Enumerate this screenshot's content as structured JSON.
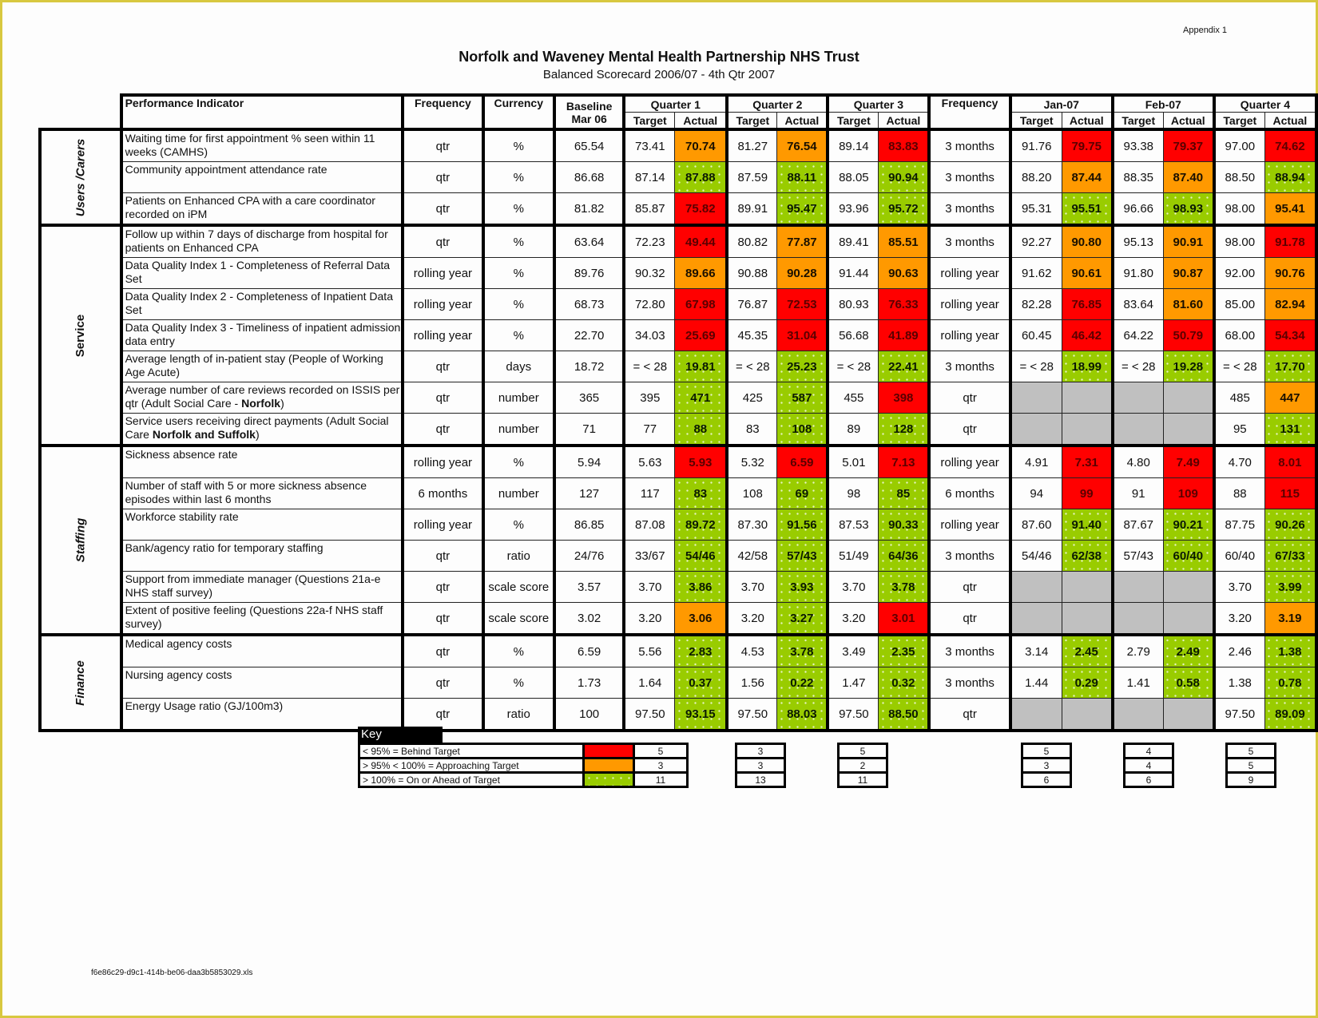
{
  "document": {
    "appendix_label": "Appendix 1",
    "title": "Norfolk and Waveney Mental Health Partnership NHS Trust",
    "subtitle": "Balanced Scorecard 2006/07 - 4th Qtr 2007",
    "filename": "f6e86c29-d9c1-414b-be06-daa3b5853029.xls"
  },
  "colors": {
    "behind_target": "#ff0000",
    "approaching_target": "#ff9900",
    "on_target": "#99cc00",
    "not_applicable": "#c0c0c0",
    "page_border": "#d8c840"
  },
  "headers": {
    "indicator": "Performance Indicator",
    "frequency": "Frequency",
    "currency": "Currency",
    "baseline_line1": "Baseline",
    "baseline_line2": "Mar 06",
    "q1": "Quarter 1",
    "q2": "Quarter 2",
    "q3": "Quarter 3",
    "frequency2": "Frequency",
    "jan": "Jan-07",
    "feb": "Feb-07",
    "q4": "Quarter 4",
    "target": "Target",
    "actual": "Actual"
  },
  "categories": [
    {
      "label": "Users /Carers",
      "rows": 3
    },
    {
      "label": "Service",
      "rows": 7
    },
    {
      "label": "Staffing",
      "rows": 6
    },
    {
      "label": "Finance",
      "rows": 3
    }
  ],
  "rows": [
    {
      "indicator": "Waiting time for first appointment % seen within 11 weeks (CAMHS)",
      "freq": "qtr",
      "currency": "%",
      "baseline": "65.54",
      "q1": {
        "target": "73.41",
        "actual": "70.74",
        "status": "amber"
      },
      "q2": {
        "target": "81.27",
        "actual": "76.54",
        "status": "amber"
      },
      "q3": {
        "target": "89.14",
        "actual": "83.83",
        "status": "red"
      },
      "freq2": "3 months",
      "jan": {
        "target": "91.76",
        "actual": "79.75",
        "status": "red"
      },
      "feb": {
        "target": "93.38",
        "actual": "79.37",
        "status": "red"
      },
      "q4": {
        "target": "97.00",
        "actual": "74.62",
        "status": "red"
      }
    },
    {
      "indicator": "Community appointment attendance rate",
      "freq": "qtr",
      "currency": "%",
      "baseline": "86.68",
      "q1": {
        "target": "87.14",
        "actual": "87.88",
        "status": "green"
      },
      "q2": {
        "target": "87.59",
        "actual": "88.11",
        "status": "green"
      },
      "q3": {
        "target": "88.05",
        "actual": "90.94",
        "status": "green"
      },
      "freq2": "3 months",
      "jan": {
        "target": "88.20",
        "actual": "87.44",
        "status": "amber"
      },
      "feb": {
        "target": "88.35",
        "actual": "87.40",
        "status": "amber"
      },
      "q4": {
        "target": "88.50",
        "actual": "88.94",
        "status": "green"
      }
    },
    {
      "indicator": "Patients on Enhanced CPA with a care coordinator recorded on iPM",
      "freq": "qtr",
      "currency": "%",
      "baseline": "81.82",
      "q1": {
        "target": "85.87",
        "actual": "75.82",
        "status": "red"
      },
      "q2": {
        "target": "89.91",
        "actual": "95.47",
        "status": "green"
      },
      "q3": {
        "target": "93.96",
        "actual": "95.72",
        "status": "green"
      },
      "freq2": "3 months",
      "jan": {
        "target": "95.31",
        "actual": "95.51",
        "status": "green"
      },
      "feb": {
        "target": "96.66",
        "actual": "98.93",
        "status": "green"
      },
      "q4": {
        "target": "98.00",
        "actual": "95.41",
        "status": "amber"
      }
    },
    {
      "indicator": "Follow up within 7 days of discharge from hospital for patients on Enhanced CPA",
      "freq": "qtr",
      "currency": "%",
      "baseline": "63.64",
      "q1": {
        "target": "72.23",
        "actual": "49.44",
        "status": "red"
      },
      "q2": {
        "target": "80.82",
        "actual": "77.87",
        "status": "amber"
      },
      "q3": {
        "target": "89.41",
        "actual": "85.51",
        "status": "amber"
      },
      "freq2": "3 months",
      "jan": {
        "target": "92.27",
        "actual": "90.80",
        "status": "amber"
      },
      "feb": {
        "target": "95.13",
        "actual": "90.91",
        "status": "amber"
      },
      "q4": {
        "target": "98.00",
        "actual": "91.78",
        "status": "red"
      }
    },
    {
      "indicator": "Data Quality Index 1 - Completeness of Referral Data Set",
      "freq": "rolling year",
      "currency": "%",
      "baseline": "89.76",
      "q1": {
        "target": "90.32",
        "actual": "89.66",
        "status": "amber"
      },
      "q2": {
        "target": "90.88",
        "actual": "90.28",
        "status": "amber"
      },
      "q3": {
        "target": "91.44",
        "actual": "90.63",
        "status": "amber"
      },
      "freq2": "rolling year",
      "jan": {
        "target": "91.62",
        "actual": "90.61",
        "status": "amber"
      },
      "feb": {
        "target": "91.80",
        "actual": "90.87",
        "status": "amber"
      },
      "q4": {
        "target": "92.00",
        "actual": "90.76",
        "status": "amber"
      }
    },
    {
      "indicator": "Data Quality Index 2 - Completeness of Inpatient Data Set",
      "freq": "rolling year",
      "currency": "%",
      "baseline": "68.73",
      "q1": {
        "target": "72.80",
        "actual": "67.98",
        "status": "red"
      },
      "q2": {
        "target": "76.87",
        "actual": "72.53",
        "status": "red"
      },
      "q3": {
        "target": "80.93",
        "actual": "76.33",
        "status": "red"
      },
      "freq2": "rolling year",
      "jan": {
        "target": "82.28",
        "actual": "76.85",
        "status": "red"
      },
      "feb": {
        "target": "83.64",
        "actual": "81.60",
        "status": "amber"
      },
      "q4": {
        "target": "85.00",
        "actual": "82.94",
        "status": "amber"
      }
    },
    {
      "indicator": "Data Quality Index 3 - Timeliness of inpatient admission data entry",
      "freq": "rolling year",
      "currency": "%",
      "baseline": "22.70",
      "q1": {
        "target": "34.03",
        "actual": "25.69",
        "status": "red"
      },
      "q2": {
        "target": "45.35",
        "actual": "31.04",
        "status": "red"
      },
      "q3": {
        "target": "56.68",
        "actual": "41.89",
        "status": "red"
      },
      "freq2": "rolling year",
      "jan": {
        "target": "60.45",
        "actual": "46.42",
        "status": "red"
      },
      "feb": {
        "target": "64.22",
        "actual": "50.79",
        "status": "red"
      },
      "q4": {
        "target": "68.00",
        "actual": "54.34",
        "status": "red"
      }
    },
    {
      "indicator": "Average length of in-patient stay (People of Working Age Acute)",
      "freq": "qtr",
      "currency": "days",
      "baseline": "18.72",
      "q1": {
        "target": "= < 28",
        "actual": "19.81",
        "status": "green"
      },
      "q2": {
        "target": "= < 28",
        "actual": "25.23",
        "status": "green"
      },
      "q3": {
        "target": "= < 28",
        "actual": "22.41",
        "status": "green"
      },
      "freq2": "3 months",
      "jan": {
        "target": "= < 28",
        "actual": "18.99",
        "status": "green"
      },
      "feb": {
        "target": "= < 28",
        "actual": "19.28",
        "status": "green"
      },
      "q4": {
        "target": "= < 28",
        "actual": "17.70",
        "status": "green"
      }
    },
    {
      "indicator": "Average number of care reviews recorded on ISSIS per qtr (Adult Social Care - ",
      "indicator_bold": "Norfolk",
      "indicator_tail": ")",
      "freq": "qtr",
      "currency": "number",
      "baseline": "365",
      "q1": {
        "target": "395",
        "actual": "471",
        "status": "green"
      },
      "q2": {
        "target": "425",
        "actual": "587",
        "status": "green"
      },
      "q3": {
        "target": "455",
        "actual": "398",
        "status": "red"
      },
      "freq2": "qtr",
      "jan": {
        "target": "",
        "actual": "",
        "status": "grey"
      },
      "feb": {
        "target": "",
        "actual": "",
        "status": "grey"
      },
      "q4": {
        "target": "485",
        "actual": "447",
        "status": "amber"
      }
    },
    {
      "indicator": "Service users receiving direct payments (Adult Social Care ",
      "indicator_bold": "Norfolk and Suffolk",
      "indicator_tail": ")",
      "freq": "qtr",
      "currency": "number",
      "baseline": "71",
      "q1": {
        "target": "77",
        "actual": "88",
        "status": "green"
      },
      "q2": {
        "target": "83",
        "actual": "108",
        "status": "green"
      },
      "q3": {
        "target": "89",
        "actual": "128",
        "status": "green"
      },
      "freq2": "qtr",
      "jan": {
        "target": "",
        "actual": "",
        "status": "grey"
      },
      "feb": {
        "target": "",
        "actual": "",
        "status": "grey"
      },
      "q4": {
        "target": "95",
        "actual": "131",
        "status": "green"
      }
    },
    {
      "indicator": "Sickness absence rate",
      "freq": "rolling year",
      "currency": "%",
      "baseline": "5.94",
      "q1": {
        "target": "5.63",
        "actual": "5.93",
        "status": "red"
      },
      "q2": {
        "target": "5.32",
        "actual": "6.59",
        "status": "red"
      },
      "q3": {
        "target": "5.01",
        "actual": "7.13",
        "status": "red"
      },
      "freq2": "rolling year",
      "jan": {
        "target": "4.91",
        "actual": "7.31",
        "status": "red"
      },
      "feb": {
        "target": "4.80",
        "actual": "7.49",
        "status": "red"
      },
      "q4": {
        "target": "4.70",
        "actual": "8.01",
        "status": "red"
      }
    },
    {
      "indicator": "Number of staff with 5 or more sickness absence episodes within last 6 months",
      "freq": "6 months",
      "currency": "number",
      "baseline": "127",
      "q1": {
        "target": "117",
        "actual": "83",
        "status": "green"
      },
      "q2": {
        "target": "108",
        "actual": "69",
        "status": "green"
      },
      "q3": {
        "target": "98",
        "actual": "85",
        "status": "green"
      },
      "freq2": "6 months",
      "jan": {
        "target": "94",
        "actual": "99",
        "status": "red"
      },
      "feb": {
        "target": "91",
        "actual": "109",
        "status": "red"
      },
      "q4": {
        "target": "88",
        "actual": "115",
        "status": "red"
      }
    },
    {
      "indicator": "Workforce stability rate",
      "freq": "rolling year",
      "currency": "%",
      "baseline": "86.85",
      "q1": {
        "target": "87.08",
        "actual": "89.72",
        "status": "green"
      },
      "q2": {
        "target": "87.30",
        "actual": "91.56",
        "status": "green"
      },
      "q3": {
        "target": "87.53",
        "actual": "90.33",
        "status": "green"
      },
      "freq2": "rolling year",
      "jan": {
        "target": "87.60",
        "actual": "91.40",
        "status": "green"
      },
      "feb": {
        "target": "87.67",
        "actual": "90.21",
        "status": "green"
      },
      "q4": {
        "target": "87.75",
        "actual": "90.26",
        "status": "green"
      }
    },
    {
      "indicator": "Bank/agency ratio for temporary staffing",
      "freq": "qtr",
      "currency": "ratio",
      "baseline": "24/76",
      "q1": {
        "target": "33/67",
        "actual": "54/46",
        "status": "green"
      },
      "q2": {
        "target": "42/58",
        "actual": "57/43",
        "status": "green"
      },
      "q3": {
        "target": "51/49",
        "actual": "64/36",
        "status": "green"
      },
      "freq2": "3 months",
      "jan": {
        "target": "54/46",
        "actual": "62/38",
        "status": "green"
      },
      "feb": {
        "target": "57/43",
        "actual": "60/40",
        "status": "green"
      },
      "q4": {
        "target": "60/40",
        "actual": "67/33",
        "status": "green"
      }
    },
    {
      "indicator": "Support from immediate manager (Questions 21a-e NHS staff survey)",
      "freq": "qtr",
      "currency": "scale score",
      "baseline": "3.57",
      "q1": {
        "target": "3.70",
        "actual": "3.86",
        "status": "green"
      },
      "q2": {
        "target": "3.70",
        "actual": "3.93",
        "status": "green"
      },
      "q3": {
        "target": "3.70",
        "actual": "3.78",
        "status": "green"
      },
      "freq2": "qtr",
      "jan": {
        "target": "",
        "actual": "",
        "status": "grey"
      },
      "feb": {
        "target": "",
        "actual": "",
        "status": "grey"
      },
      "q4": {
        "target": "3.70",
        "actual": "3.99",
        "status": "green"
      }
    },
    {
      "indicator": "Extent of positive feeling (Questions 22a-f NHS staff survey)",
      "freq": "qtr",
      "currency": "scale score",
      "baseline": "3.02",
      "q1": {
        "target": "3.20",
        "actual": "3.06",
        "status": "amber"
      },
      "q2": {
        "target": "3.20",
        "actual": "3.27",
        "status": "green"
      },
      "q3": {
        "target": "3.20",
        "actual": "3.01",
        "status": "red"
      },
      "freq2": "qtr",
      "jan": {
        "target": "",
        "actual": "",
        "status": "grey"
      },
      "feb": {
        "target": "",
        "actual": "",
        "status": "grey"
      },
      "q4": {
        "target": "3.20",
        "actual": "3.19",
        "status": "amber"
      }
    },
    {
      "indicator": "Medical agency costs",
      "freq": "qtr",
      "currency": "%",
      "baseline": "6.59",
      "q1": {
        "target": "5.56",
        "actual": "2.83",
        "status": "green"
      },
      "q2": {
        "target": "4.53",
        "actual": "3.78",
        "status": "green"
      },
      "q3": {
        "target": "3.49",
        "actual": "2.35",
        "status": "green"
      },
      "freq2": "3 months",
      "jan": {
        "target": "3.14",
        "actual": "2.45",
        "status": "green"
      },
      "feb": {
        "target": "2.79",
        "actual": "2.49",
        "status": "green"
      },
      "q4": {
        "target": "2.46",
        "actual": "1.38",
        "status": "green"
      }
    },
    {
      "indicator": "Nursing agency costs",
      "freq": "qtr",
      "currency": "%",
      "baseline": "1.73",
      "q1": {
        "target": "1.64",
        "actual": "0.37",
        "status": "green"
      },
      "q2": {
        "target": "1.56",
        "actual": "0.22",
        "status": "green"
      },
      "q3": {
        "target": "1.47",
        "actual": "0.32",
        "status": "green"
      },
      "freq2": "3 months",
      "jan": {
        "target": "1.44",
        "actual": "0.29",
        "status": "green"
      },
      "feb": {
        "target": "1.41",
        "actual": "0.58",
        "status": "green"
      },
      "q4": {
        "target": "1.38",
        "actual": "0.78",
        "status": "green"
      }
    },
    {
      "indicator": "Energy Usage ratio (GJ/100m3)",
      "freq": "qtr",
      "currency": "ratio",
      "baseline": "100",
      "q1": {
        "target": "97.50",
        "actual": "93.15",
        "status": "green"
      },
      "q2": {
        "target": "97.50",
        "actual": "88.03",
        "status": "green"
      },
      "q3": {
        "target": "97.50",
        "actual": "88.50",
        "status": "green"
      },
      "freq2": "qtr",
      "jan": {
        "target": "",
        "actual": "",
        "status": "grey"
      },
      "feb": {
        "target": "",
        "actual": "",
        "status": "grey"
      },
      "q4": {
        "target": "97.50",
        "actual": "89.09",
        "status": "green"
      }
    }
  ],
  "key": {
    "title": "Key",
    "items": [
      {
        "label": "< 95% = Behind Target",
        "status": "red"
      },
      {
        "label": "> 95% < 100% = Approaching Target",
        "status": "amber"
      },
      {
        "label": "> 100% = On or Ahead of Target",
        "status": "green"
      }
    ],
    "counts": {
      "q1": [
        "5",
        "3",
        "11"
      ],
      "q2": [
        "3",
        "3",
        "13"
      ],
      "q3": [
        "5",
        "2",
        "11"
      ],
      "jan": [
        "5",
        "3",
        "6"
      ],
      "feb": [
        "4",
        "4",
        "6"
      ],
      "q4": [
        "5",
        "5",
        "9"
      ]
    }
  }
}
